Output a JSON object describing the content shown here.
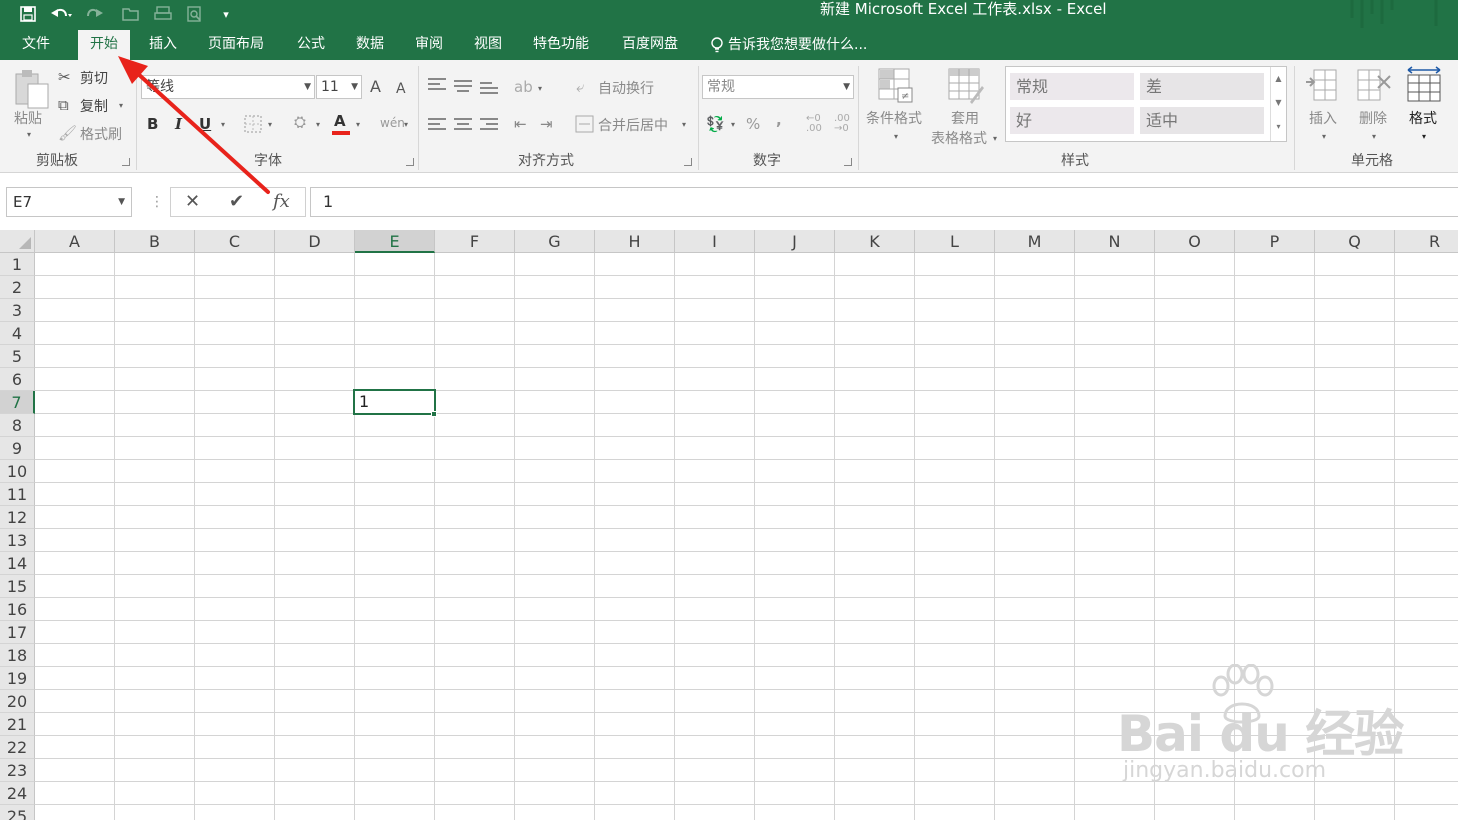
{
  "window": {
    "title": "新建 Microsoft Excel 工作表.xlsx - Excel"
  },
  "qat": {
    "save_icon": "save-icon",
    "undo_icon": "undo-icon",
    "redo_icon": "redo-icon",
    "customize": "▾"
  },
  "tabs": [
    {
      "label": "文件"
    },
    {
      "label": "开始"
    },
    {
      "label": "插入"
    },
    {
      "label": "页面布局"
    },
    {
      "label": "公式"
    },
    {
      "label": "数据"
    },
    {
      "label": "审阅"
    },
    {
      "label": "视图"
    },
    {
      "label": "特色功能"
    },
    {
      "label": "百度网盘"
    }
  ],
  "tell_me": "告诉我您想要做什么...",
  "ribbon": {
    "clipboard": {
      "paste": "粘贴",
      "cut": "剪切",
      "copy": "复制",
      "format_painter": "格式刷",
      "label": "剪贴板"
    },
    "font": {
      "font_name": "等线",
      "font_size": "11",
      "grow": "A",
      "shrink": "A",
      "bold": "B",
      "italic": "I",
      "underline": "U",
      "font_color": "A",
      "label": "字体"
    },
    "alignment": {
      "wrap_text": "自动换行",
      "merge_center": "合并后居中",
      "label": "对齐方式"
    },
    "number": {
      "format": "常规",
      "percent": "%",
      "comma": ",",
      "label": "数字"
    },
    "styles": {
      "conditional": "条件格式",
      "table_top": "套用",
      "table_bottom": "表格格式",
      "normal": "常规",
      "bad": "差",
      "good": "好",
      "neutral": "适中",
      "label": "样式"
    },
    "cells": {
      "insert": "插入",
      "delete": "删除",
      "format": "格式",
      "label": "单元格"
    }
  },
  "formula_bar": {
    "name_box": "E7",
    "separator": "⋮",
    "cancel": "✕",
    "enter": "✔",
    "fx": "fx",
    "value": "1"
  },
  "sheet": {
    "columns": [
      "A",
      "B",
      "C",
      "D",
      "E",
      "F",
      "G",
      "H",
      "I",
      "J",
      "K",
      "L",
      "M",
      "N",
      "O",
      "P",
      "Q",
      "R"
    ],
    "rows": [
      "1",
      "2",
      "3",
      "4",
      "5",
      "6",
      "7",
      "8",
      "9",
      "10",
      "11",
      "12",
      "13",
      "14",
      "15",
      "16",
      "17",
      "18",
      "19",
      "20",
      "21",
      "22",
      "23",
      "24",
      "25"
    ],
    "selected_column": "E",
    "selected_row": "7",
    "cell_value": "1"
  },
  "watermark": {
    "brand": "Bai du 经验",
    "url": "jingyan.baidu.com"
  },
  "colors": {
    "excel_green": "#217346",
    "arrow_red": "#e8231b"
  }
}
